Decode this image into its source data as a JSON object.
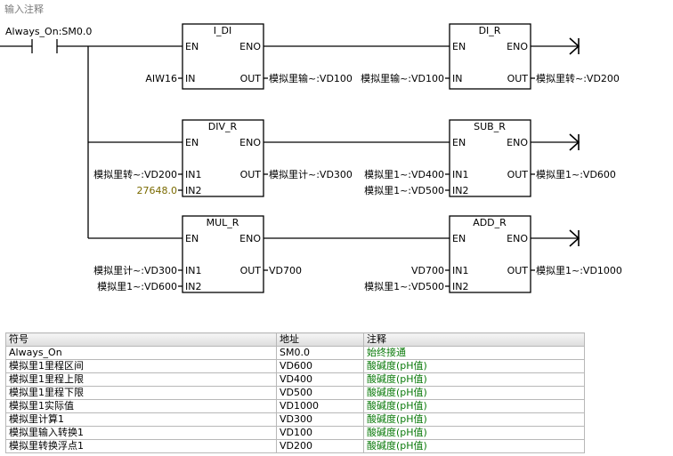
{
  "network_comment": "输入注释",
  "contact_label": "Always_On:SM0.0",
  "blocks": {
    "i_di": {
      "title": "I_DI",
      "en": "EN",
      "eno": "ENO",
      "in1": "IN",
      "out": "OUT"
    },
    "di_r": {
      "title": "DI_R",
      "en": "EN",
      "eno": "ENO",
      "in1": "IN",
      "out": "OUT"
    },
    "div_r": {
      "title": "DIV_R",
      "en": "EN",
      "eno": "ENO",
      "in1": "IN1",
      "in2": "IN2",
      "out": "OUT"
    },
    "sub_r": {
      "title": "SUB_R",
      "en": "EN",
      "eno": "ENO",
      "in1": "IN1",
      "in2": "IN2",
      "out": "OUT"
    },
    "mul_r": {
      "title": "MUL_R",
      "en": "EN",
      "eno": "ENO",
      "in1": "IN1",
      "in2": "IN2",
      "out": "OUT"
    },
    "add_r": {
      "title": "ADD_R",
      "en": "EN",
      "eno": "ENO",
      "in1": "IN1",
      "in2": "IN2",
      "out": "OUT"
    }
  },
  "operands": {
    "i_di_in": "AIW16",
    "i_di_out": "模拟里输~:VD100",
    "di_r_in": "模拟里输~:VD100",
    "di_r_out": "模拟里转~:VD200",
    "div_r_in1": "模拟里转~:VD200",
    "div_r_in2": "27648.0",
    "div_r_out": "模拟里计~:VD300",
    "sub_r_in1": "模拟里1~:VD400",
    "sub_r_in2": "模拟里1~:VD500",
    "sub_r_out": "模拟里1~:VD600",
    "mul_r_in1": "模拟里计~:VD300",
    "mul_r_in2": "模拟里1~:VD600",
    "mul_r_out": "VD700",
    "add_r_in1": "VD700",
    "add_r_in2": "模拟里1~:VD500",
    "add_r_out": "模拟里1~:VD1000"
  },
  "colors": {
    "constant": "#7a6a00",
    "comment": "#0a7a0a",
    "comment_header": "#7a7a7a"
  },
  "symbol_table": {
    "headers": [
      "符号",
      "地址",
      "注释"
    ],
    "rows": [
      [
        "Always_On",
        "SM0.0",
        "始终接通"
      ],
      [
        "模拟里1里程区间",
        "VD600",
        "酸碱度(pH值)"
      ],
      [
        "模拟里1里程上限",
        "VD400",
        "酸碱度(pH值)"
      ],
      [
        "模拟里1里程下限",
        "VD500",
        "酸碱度(pH值)"
      ],
      [
        "模拟里1实际值",
        "VD1000",
        "酸碱度(pH值)"
      ],
      [
        "模拟里计算1",
        "VD300",
        "酸碱度(pH值)"
      ],
      [
        "模拟里输入转换1",
        "VD100",
        "酸碱度(pH值)"
      ],
      [
        "模拟里转换浮点1",
        "VD200",
        "酸碱度(pH值)"
      ]
    ]
  }
}
